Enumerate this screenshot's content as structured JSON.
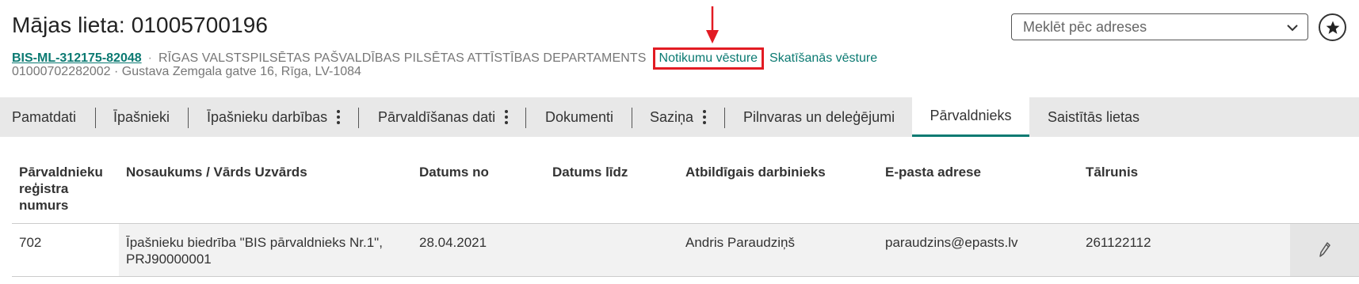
{
  "header": {
    "title": "Mājas lieta: 01005700196",
    "case_code": "BIS-ML-312175-82048",
    "separator": "·",
    "department": "RĪGAS VALSTSPILSĒTAS PAŠVALDĪBAS PILSĒTAS ATTĪSTĪBAS DEPARTAMENTS",
    "event_history_link": "Notikumu vēsture",
    "view_history_link": "Skatīšanās vēsture",
    "address_line": "01000702282002 · Gustava Zemgala gatve 16, Rīga, LV-1084"
  },
  "search": {
    "placeholder": "Meklēt pēc adreses"
  },
  "tabs": [
    {
      "label": "Pamatdati"
    },
    {
      "label": "Īpašnieki"
    },
    {
      "label": "Īpašnieku darbības"
    },
    {
      "label": "Pārvaldīšanas dati"
    },
    {
      "label": "Dokumenti"
    },
    {
      "label": "Saziņa"
    },
    {
      "label": "Pilnvaras un deleģējumi"
    },
    {
      "label": "Pārvaldnieks"
    },
    {
      "label": "Saistītās lietas"
    }
  ],
  "table": {
    "headers": [
      "Pārvaldnieku reģistra numurs",
      "Nosaukums / Vārds Uzvārds",
      "Datums no",
      "Datums līdz",
      "Atbildīgais darbinieks",
      "E-pasta adrese",
      "Tālrunis"
    ],
    "rows": [
      {
        "reg_number": "702",
        "name_line1": "Īpašnieku biedrība \"BIS pārvaldnieks Nr.1\",",
        "name_line2": "PRJ90000001",
        "date_from": "28.04.2021",
        "date_to": "",
        "employee": "Andris Paraudziņš",
        "email": "paraudzins@epasts.lv",
        "phone": "261122112"
      }
    ]
  },
  "colors": {
    "accent": "#0b7a72",
    "highlight": "#e21b23",
    "tabbar": "#e8e8e8"
  }
}
